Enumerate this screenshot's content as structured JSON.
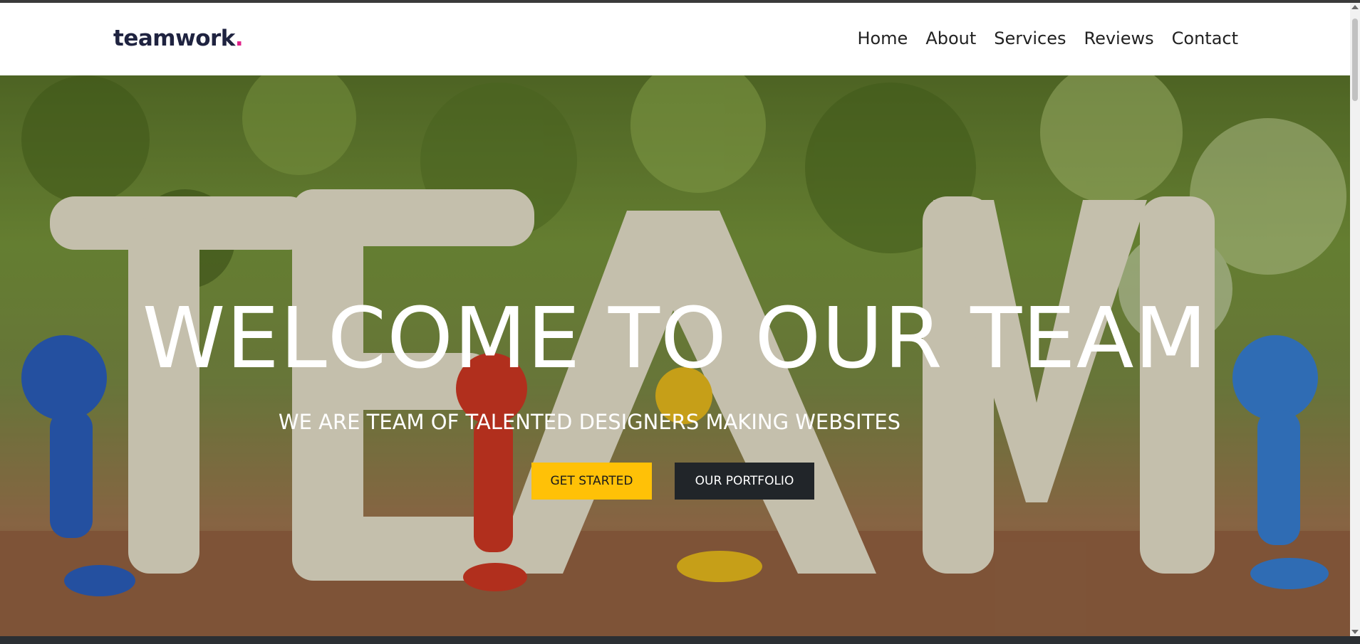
{
  "brand": {
    "name": "teamwork",
    "dot": ".",
    "dot_color": "#e0218a"
  },
  "nav": {
    "items": [
      {
        "label": "Home"
      },
      {
        "label": "About"
      },
      {
        "label": "Services"
      },
      {
        "label": "Reviews"
      },
      {
        "label": "Contact"
      }
    ]
  },
  "hero": {
    "title": "WELCOME TO OUR TEAM",
    "subtitle": "WE ARE TEAM OF TALENTED DESIGNERS MAKING WEBSITES",
    "primary_button": "GET STARTED",
    "secondary_button": "OUR PORTFOLIO",
    "background_image_letters": "TEAM"
  },
  "colors": {
    "accent_yellow": "#ffc107",
    "dark_button": "#212529",
    "brand_text": "#1f2340"
  }
}
